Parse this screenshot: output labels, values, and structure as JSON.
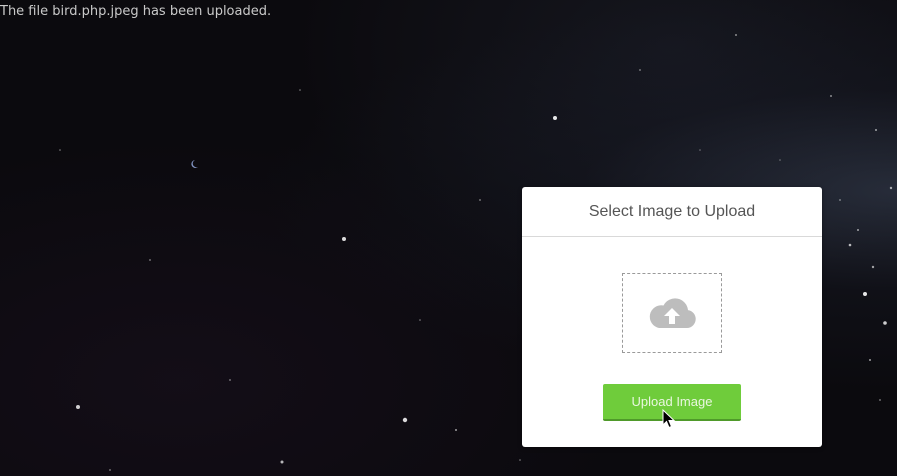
{
  "status": {
    "message": "The file bird.php.jpeg has been uploaded."
  },
  "upload_panel": {
    "title": "Select Image to Upload",
    "drop_zone_icon": "cloud-upload-icon",
    "button_label": "Upload Image"
  },
  "colors": {
    "background": "#0b0a0e",
    "card_background": "#ffffff",
    "button_green": "#6fcc3b",
    "button_text": "#e9f7df",
    "title_text": "#555555",
    "status_text": "#c9c9c9"
  }
}
